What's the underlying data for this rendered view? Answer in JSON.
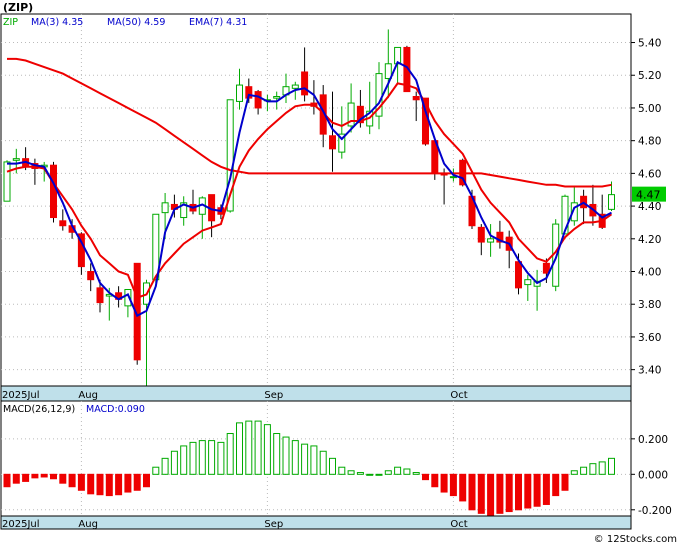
{
  "chart_data": {
    "type": "candlestick",
    "ticker_label": "(ZIP)",
    "legend": [
      {
        "label": "ZIP",
        "color": "#00aa00"
      },
      {
        "label": "MA(3)",
        "value": "4.35",
        "color": "#0000cc"
      },
      {
        "label": "MA(50)",
        "value": "4.59",
        "color": "#0000cc"
      },
      {
        "label": "EMA(7)",
        "value": "4.31",
        "color": "#0000cc"
      }
    ],
    "price_ylim": [
      3.3,
      5.55
    ],
    "price_ticks": [
      "5.40",
      "5.20",
      "5.00",
      "4.80",
      "4.60",
      "4.40",
      "4.20",
      "4.00",
      "3.80",
      "3.60",
      "3.40"
    ],
    "last_price_label": "4.47",
    "x_month_labels": [
      {
        "label": "2025Jul",
        "index": 0
      },
      {
        "label": "Aug",
        "index": 8
      },
      {
        "label": "Sep",
        "index": 28
      },
      {
        "label": "Oct",
        "index": 48
      }
    ],
    "ohlc": [
      [
        4.43,
        4.68,
        4.43,
        4.67
      ],
      [
        4.68,
        4.75,
        4.6,
        4.69
      ],
      [
        4.69,
        4.76,
        4.62,
        4.64
      ],
      [
        4.66,
        4.69,
        4.53,
        4.63
      ],
      [
        4.64,
        4.67,
        4.55,
        4.65
      ],
      [
        4.65,
        4.67,
        4.3,
        4.33
      ],
      [
        4.31,
        4.38,
        4.25,
        4.28
      ],
      [
        4.28,
        4.32,
        4.2,
        4.24
      ],
      [
        4.23,
        4.24,
        3.98,
        4.03
      ],
      [
        4.0,
        4.05,
        3.88,
        3.95
      ],
      [
        3.9,
        3.95,
        3.75,
        3.81
      ],
      [
        3.85,
        3.9,
        3.7,
        3.86
      ],
      [
        3.87,
        3.91,
        3.78,
        3.83
      ],
      [
        3.79,
        3.89,
        3.72,
        3.89
      ],
      [
        4.05,
        4.05,
        3.43,
        3.46
      ],
      [
        3.8,
        3.95,
        3.3,
        3.93
      ],
      [
        3.95,
        4.35,
        3.93,
        4.35
      ],
      [
        4.36,
        4.48,
        4.2,
        4.42
      ],
      [
        4.41,
        4.47,
        4.33,
        4.38
      ],
      [
        4.33,
        4.46,
        4.28,
        4.42
      ],
      [
        4.41,
        4.5,
        4.35,
        4.37
      ],
      [
        4.35,
        4.46,
        4.2,
        4.45
      ],
      [
        4.47,
        4.47,
        4.21,
        4.31
      ],
      [
        4.39,
        4.41,
        4.32,
        4.35
      ],
      [
        4.37,
        5.05,
        4.36,
        5.05
      ],
      [
        5.04,
        5.24,
        4.99,
        5.14
      ],
      [
        5.13,
        5.18,
        5.03,
        5.06
      ],
      [
        5.1,
        5.11,
        4.96,
        5.0
      ],
      [
        5.05,
        5.08,
        4.98,
        5.05
      ],
      [
        5.06,
        5.1,
        4.99,
        5.07
      ],
      [
        5.08,
        5.21,
        5.03,
        5.13
      ],
      [
        5.12,
        5.16,
        5.05,
        5.14
      ],
      [
        5.22,
        5.37,
        5.04,
        5.08
      ],
      [
        5.03,
        5.17,
        4.96,
        5.01
      ],
      [
        5.08,
        5.14,
        4.76,
        4.84
      ],
      [
        4.83,
        5.1,
        4.61,
        4.75
      ],
      [
        4.73,
        5.01,
        4.69,
        4.84
      ],
      [
        4.89,
        5.15,
        4.85,
        5.03
      ],
      [
        5.01,
        5.11,
        4.88,
        4.91
      ],
      [
        4.89,
        5.16,
        4.84,
        4.98
      ],
      [
        4.95,
        5.28,
        4.87,
        5.21
      ],
      [
        5.18,
        5.48,
        5.06,
        5.27
      ],
      [
        5.27,
        5.37,
        5.15,
        5.37
      ],
      [
        5.37,
        5.38,
        5.1,
        5.1
      ],
      [
        5.07,
        5.1,
        4.92,
        5.05
      ],
      [
        5.06,
        5.06,
        4.77,
        4.78
      ],
      [
        4.8,
        4.81,
        4.56,
        4.6
      ],
      [
        4.6,
        4.63,
        4.41,
        4.59
      ],
      [
        4.58,
        4.63,
        4.55,
        4.58
      ],
      [
        4.68,
        4.69,
        4.52,
        4.53
      ],
      [
        4.46,
        4.5,
        4.26,
        4.28
      ],
      [
        4.27,
        4.29,
        4.1,
        4.18
      ],
      [
        4.18,
        4.29,
        4.09,
        4.2
      ],
      [
        4.24,
        4.31,
        4.14,
        4.18
      ],
      [
        4.21,
        4.25,
        4.02,
        4.13
      ],
      [
        4.06,
        4.11,
        3.86,
        3.9
      ],
      [
        3.92,
        3.98,
        3.82,
        3.95
      ],
      [
        3.91,
        4.01,
        3.76,
        3.94
      ],
      [
        4.05,
        4.08,
        3.93,
        3.99
      ],
      [
        3.91,
        4.32,
        3.88,
        4.29
      ],
      [
        4.23,
        4.47,
        4.23,
        4.46
      ],
      [
        4.31,
        4.52,
        4.28,
        4.42
      ],
      [
        4.46,
        4.5,
        4.29,
        4.39
      ],
      [
        4.41,
        4.53,
        4.28,
        4.34
      ],
      [
        4.35,
        4.47,
        4.26,
        4.27
      ],
      [
        4.38,
        4.55,
        4.37,
        4.47
      ]
    ],
    "ma3": [
      4.66,
      4.66,
      4.67,
      4.65,
      4.64,
      4.54,
      4.42,
      4.28,
      4.18,
      4.07,
      3.93,
      3.87,
      3.83,
      3.86,
      3.73,
      3.76,
      3.91,
      4.24,
      4.38,
      4.41,
      4.39,
      4.41,
      4.38,
      4.37,
      4.57,
      4.85,
      5.08,
      5.07,
      5.04,
      5.04,
      5.08,
      5.11,
      5.12,
      5.08,
      4.98,
      4.87,
      4.81,
      4.87,
      4.93,
      4.97,
      5.03,
      5.15,
      5.28,
      5.25,
      5.17,
      4.98,
      4.81,
      4.66,
      4.59,
      4.57,
      4.46,
      4.33,
      4.22,
      4.19,
      4.17,
      4.07,
      3.99,
      3.93,
      3.96,
      4.08,
      4.25,
      4.39,
      4.42,
      4.38,
      4.33,
      4.36
    ],
    "ma50": [
      5.3,
      5.3,
      5.29,
      5.27,
      5.25,
      5.23,
      5.21,
      5.18,
      5.15,
      5.12,
      5.09,
      5.06,
      5.03,
      5.0,
      4.97,
      4.94,
      4.91,
      4.87,
      4.83,
      4.79,
      4.75,
      4.71,
      4.67,
      4.64,
      4.62,
      4.61,
      4.6,
      4.6,
      4.6,
      4.6,
      4.6,
      4.6,
      4.6,
      4.6,
      4.6,
      4.6,
      4.6,
      4.6,
      4.6,
      4.6,
      4.6,
      4.6,
      4.6,
      4.6,
      4.6,
      4.6,
      4.6,
      4.6,
      4.6,
      4.6,
      4.6,
      4.6,
      4.59,
      4.58,
      4.57,
      4.56,
      4.55,
      4.54,
      4.53,
      4.53,
      4.52,
      4.52,
      4.52,
      4.52,
      4.52,
      4.53
    ],
    "ema7": [
      4.61,
      4.63,
      4.64,
      4.64,
      4.63,
      4.54,
      4.46,
      4.38,
      4.28,
      4.2,
      4.1,
      4.05,
      4.0,
      3.98,
      3.84,
      3.86,
      3.97,
      4.05,
      4.11,
      4.17,
      4.21,
      4.25,
      4.27,
      4.29,
      4.47,
      4.64,
      4.74,
      4.81,
      4.87,
      4.92,
      4.97,
      5.01,
      5.02,
      5.02,
      4.97,
      4.91,
      4.89,
      4.92,
      4.92,
      4.94,
      5.0,
      5.07,
      5.15,
      5.14,
      5.12,
      5.03,
      4.92,
      4.84,
      4.78,
      4.72,
      4.61,
      4.5,
      4.42,
      4.36,
      4.3,
      4.2,
      4.14,
      4.08,
      4.06,
      4.12,
      4.21,
      4.26,
      4.3,
      4.3,
      4.31,
      4.35
    ],
    "macd_label": "MACD(26,12,9)",
    "macd_value_label": "MACD:0.090",
    "macd_ylim": [
      -0.235,
      0.34
    ],
    "macd_ticks": [
      "0.200",
      "0.000",
      "-0.200"
    ],
    "macd_hist": [
      -0.07,
      -0.05,
      -0.04,
      -0.02,
      -0.015,
      -0.025,
      -0.05,
      -0.07,
      -0.09,
      -0.11,
      -0.115,
      -0.12,
      -0.115,
      -0.1,
      -0.09,
      -0.07,
      0.04,
      0.09,
      0.13,
      0.16,
      0.18,
      0.19,
      0.19,
      0.18,
      0.23,
      0.29,
      0.3,
      0.3,
      0.28,
      0.23,
      0.21,
      0.19,
      0.17,
      0.16,
      0.13,
      0.09,
      0.04,
      0.02,
      0.01,
      0.0,
      0.0,
      0.02,
      0.04,
      0.03,
      0.01,
      -0.03,
      -0.07,
      -0.1,
      -0.12,
      -0.15,
      -0.2,
      -0.22,
      -0.23,
      -0.22,
      -0.21,
      -0.2,
      -0.19,
      -0.18,
      -0.17,
      -0.12,
      -0.09,
      0.02,
      0.04,
      0.06,
      0.07,
      0.09
    ],
    "colors": {
      "up": "#00aa00",
      "down": "#ee0000",
      "ma3": "#0000cc",
      "ema7": "#ee0000",
      "ma50_line": "#0000cc",
      "ema_line": "#ee0000",
      "axis_band": "#bfe0ea",
      "grid": "#bbbbbb",
      "price_tag": "#00cc00"
    }
  },
  "footer": {
    "credit": "© 12Stocks.com"
  }
}
